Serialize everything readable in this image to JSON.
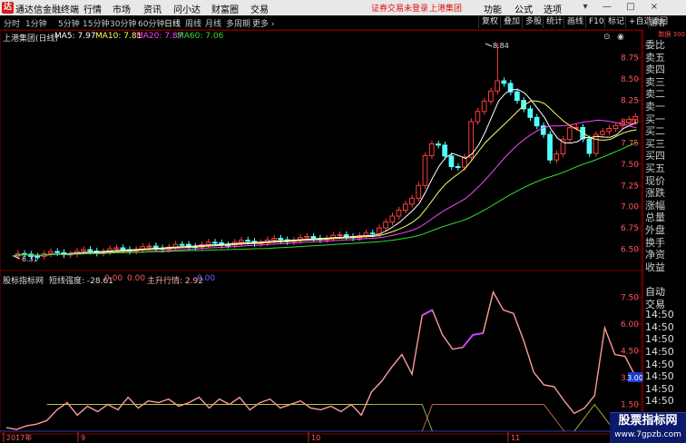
{
  "menubar": {
    "app_name": "通达信金融终端",
    "items": [
      "行情",
      "市场",
      "资讯",
      "问小达",
      "财富圈",
      "交易"
    ],
    "warning": "证券交易未登录",
    "stock": "上港集团",
    "right_items": [
      "功能",
      "公式",
      "选项"
    ],
    "controls": [
      "▾",
      "—",
      "□",
      "×"
    ]
  },
  "toolbar": {
    "periods": [
      "分时",
      "1分钟",
      "5分钟",
      "15分钟",
      "30分钟",
      "60分钟",
      "日线",
      "周线",
      "月线",
      "多周期",
      "更多 ›"
    ],
    "active": "日线",
    "buttons": [
      "复权",
      "叠加",
      "多股",
      "统计",
      "画线",
      "F10",
      "标记",
      "+自选",
      "返回"
    ]
  },
  "chart": {
    "title": "上港集团(日线)",
    "ma": [
      {
        "label": "MA5: 7.97",
        "color": "#ffffff"
      },
      {
        "label": "MA10: 7.81",
        "color": "#ffff66"
      },
      {
        "label": "MA20: 7.87",
        "color": "#ff44ff"
      },
      {
        "label": "MA60: 7.06",
        "color": "#33dd33"
      }
    ],
    "price_axis": [
      "8.75",
      "8.50",
      "8.25",
      "8.00",
      "7.75",
      "7.50",
      "7.25",
      "7.00",
      "6.75",
      "6.50"
    ],
    "high_label": "8.84",
    "low_label": "6.31",
    "indicator_title": "股标指标网",
    "indicator_line1": "短线强度: -28.61",
    "indicator_line2": "0.00",
    "indicator_line3": "0.00",
    "indicator_line4": "主升行情: 2.92",
    "indicator_line5": "0.00",
    "ind_axis": [
      "7.50",
      "6.00",
      "4.50",
      "3.00",
      "1.50"
    ],
    "current_value": "3.00",
    "date_labels": [
      "2017年",
      "9",
      "10",
      "11"
    ],
    "colors": {
      "up": "#ff3c3c",
      "down": "#54ffff",
      "ma5": "#ffffff",
      "ma10": "#ffff66",
      "ma20": "#ff44ff",
      "ma60": "#33dd33",
      "grid": "#7a0000",
      "ind": "#ff9a9a"
    }
  },
  "right_panel": {
    "header": "数据 300",
    "items": [
      "委比",
      "卖五",
      "卖四",
      "卖三",
      "卖二",
      "卖一",
      "买一",
      "买二",
      "买三",
      "买四",
      "买五",
      "现价",
      "涨跌",
      "涨幅",
      "总量",
      "外盘",
      "换手",
      "净资",
      "收益",
      "",
      "自动",
      "交易",
      "14:50",
      "14:50",
      "14:50",
      "14:50",
      "14:50",
      "14:50",
      "14:50",
      "14:50"
    ]
  },
  "watermark": {
    "line1": "股票指标网",
    "line2": "www.7gpzb.com"
  },
  "tag_visitor": "游客"
}
